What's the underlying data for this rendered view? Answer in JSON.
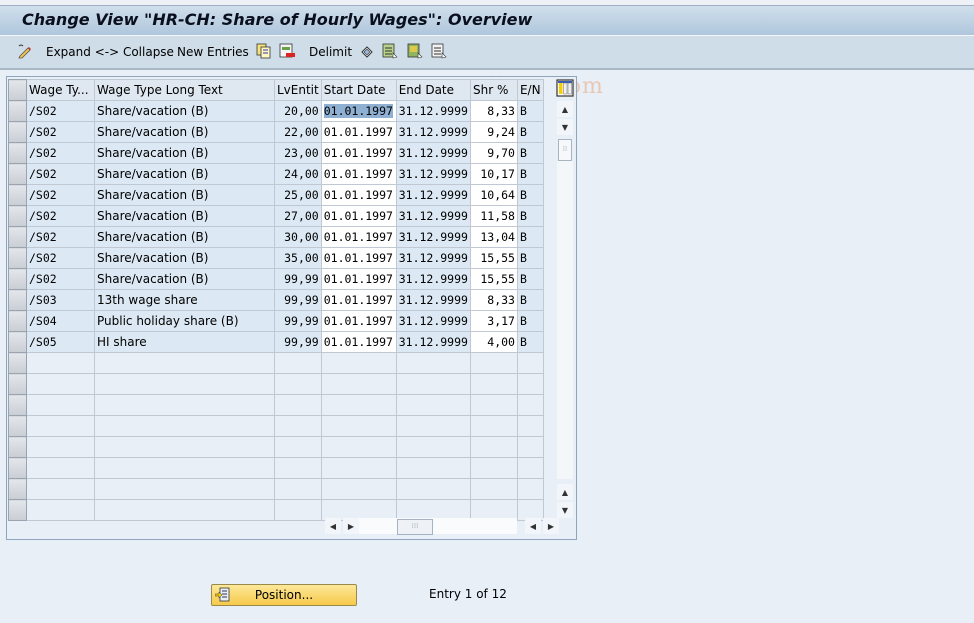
{
  "window": {
    "title": "Change View \"HR-CH: Share of Hourly Wages\": Overview"
  },
  "toolbar": {
    "items": [
      {
        "icon": "display-change-icon",
        "label": ""
      },
      {
        "icon": "",
        "label": "Expand <-> Collapse"
      },
      {
        "icon": "",
        "label": "New Entries"
      },
      {
        "icon": "copy-icon",
        "label": ""
      },
      {
        "icon": "delete-icon",
        "label": ""
      },
      {
        "icon": "",
        "label": "Delimit"
      },
      {
        "icon": "undo-change-icon",
        "label": ""
      },
      {
        "icon": "select-all-icon",
        "label": ""
      },
      {
        "icon": "select-block-icon",
        "label": ""
      },
      {
        "icon": "deselect-all-icon",
        "label": ""
      }
    ],
    "watermark": "©www.tutorialkart.com"
  },
  "table": {
    "columns": [
      "Wage Ty...",
      "Wage Type Long Text",
      "LvEntit",
      "Start Date",
      "End Date",
      "Shr %",
      "E/N"
    ],
    "rows": [
      {
        "wage_type": "/S02",
        "long_text": "Share/vacation (B)",
        "lv_entit": "20,00",
        "start_date": "01.01.1997",
        "end_date": "31.12.9999",
        "shr_pct": "8,33",
        "e_n": "B"
      },
      {
        "wage_type": "/S02",
        "long_text": "Share/vacation (B)",
        "lv_entit": "22,00",
        "start_date": "01.01.1997",
        "end_date": "31.12.9999",
        "shr_pct": "9,24",
        "e_n": "B"
      },
      {
        "wage_type": "/S02",
        "long_text": "Share/vacation (B)",
        "lv_entit": "23,00",
        "start_date": "01.01.1997",
        "end_date": "31.12.9999",
        "shr_pct": "9,70",
        "e_n": "B"
      },
      {
        "wage_type": "/S02",
        "long_text": "Share/vacation (B)",
        "lv_entit": "24,00",
        "start_date": "01.01.1997",
        "end_date": "31.12.9999",
        "shr_pct": "10,17",
        "e_n": "B"
      },
      {
        "wage_type": "/S02",
        "long_text": "Share/vacation (B)",
        "lv_entit": "25,00",
        "start_date": "01.01.1997",
        "end_date": "31.12.9999",
        "shr_pct": "10,64",
        "e_n": "B"
      },
      {
        "wage_type": "/S02",
        "long_text": "Share/vacation (B)",
        "lv_entit": "27,00",
        "start_date": "01.01.1997",
        "end_date": "31.12.9999",
        "shr_pct": "11,58",
        "e_n": "B"
      },
      {
        "wage_type": "/S02",
        "long_text": "Share/vacation (B)",
        "lv_entit": "30,00",
        "start_date": "01.01.1997",
        "end_date": "31.12.9999",
        "shr_pct": "13,04",
        "e_n": "B"
      },
      {
        "wage_type": "/S02",
        "long_text": "Share/vacation (B)",
        "lv_entit": "35,00",
        "start_date": "01.01.1997",
        "end_date": "31.12.9999",
        "shr_pct": "15,55",
        "e_n": "B"
      },
      {
        "wage_type": "/S02",
        "long_text": "Share/vacation (B)",
        "lv_entit": "99,99",
        "start_date": "01.01.1997",
        "end_date": "31.12.9999",
        "shr_pct": "15,55",
        "e_n": "B"
      },
      {
        "wage_type": "/S03",
        "long_text": "13th wage share",
        "lv_entit": "99,99",
        "start_date": "01.01.1997",
        "end_date": "31.12.9999",
        "shr_pct": "8,33",
        "e_n": "B"
      },
      {
        "wage_type": "/S04",
        "long_text": "Public holiday share (B)",
        "lv_entit": "99,99",
        "start_date": "01.01.1997",
        "end_date": "31.12.9999",
        "shr_pct": "3,17",
        "e_n": "B"
      },
      {
        "wage_type": "/S05",
        "long_text": "HI share",
        "lv_entit": "99,99",
        "start_date": "01.01.1997",
        "end_date": "31.12.9999",
        "shr_pct": "4,00",
        "e_n": "B"
      }
    ],
    "empty_rows": 8
  },
  "footer": {
    "position_button": "Position...",
    "entry_info": "Entry 1 of 12"
  }
}
